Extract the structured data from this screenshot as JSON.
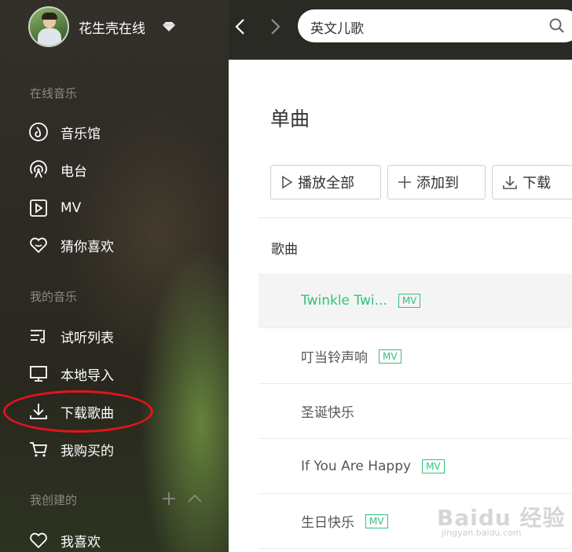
{
  "user": {
    "name": "花生壳在线"
  },
  "search": {
    "value": "英文儿歌"
  },
  "sidebar": {
    "online_label": "在线音乐",
    "online_items": [
      {
        "label": "音乐馆",
        "icon": "music-hall-icon"
      },
      {
        "label": "电台",
        "icon": "radio-icon"
      },
      {
        "label": "MV",
        "icon": "mv-play-icon"
      },
      {
        "label": "猜你喜欢",
        "icon": "heart-smile-icon"
      }
    ],
    "my_label": "我的音乐",
    "my_items": [
      {
        "label": "试听列表",
        "icon": "playlist-icon"
      },
      {
        "label": "本地导入",
        "icon": "monitor-icon"
      },
      {
        "label": "下载歌曲",
        "icon": "download-icon"
      },
      {
        "label": "我购买的",
        "icon": "cart-icon"
      }
    ],
    "created_label": "我创建的",
    "created_items": [
      {
        "label": "我喜欢",
        "icon": "heart-icon"
      }
    ]
  },
  "main": {
    "title": "单曲",
    "buttons": {
      "play_all": "播放全部",
      "add_to": "添加到",
      "download": "下载"
    },
    "column_header": "歌曲",
    "songs": [
      {
        "title": "Twinkle Twi...",
        "mv": "MV",
        "active": true
      },
      {
        "title": "叮当铃声响",
        "mv": "MV"
      },
      {
        "title": "圣诞快乐"
      },
      {
        "title": "If You Are Happy",
        "mv": "MV"
      },
      {
        "title": "生日快乐",
        "mv": "MV"
      }
    ]
  },
  "colors": {
    "accent": "#31c27c",
    "highlight": "#e2141b"
  },
  "watermark": {
    "text": "Baidu 经验",
    "sub": "jingyan.baidu.com"
  }
}
